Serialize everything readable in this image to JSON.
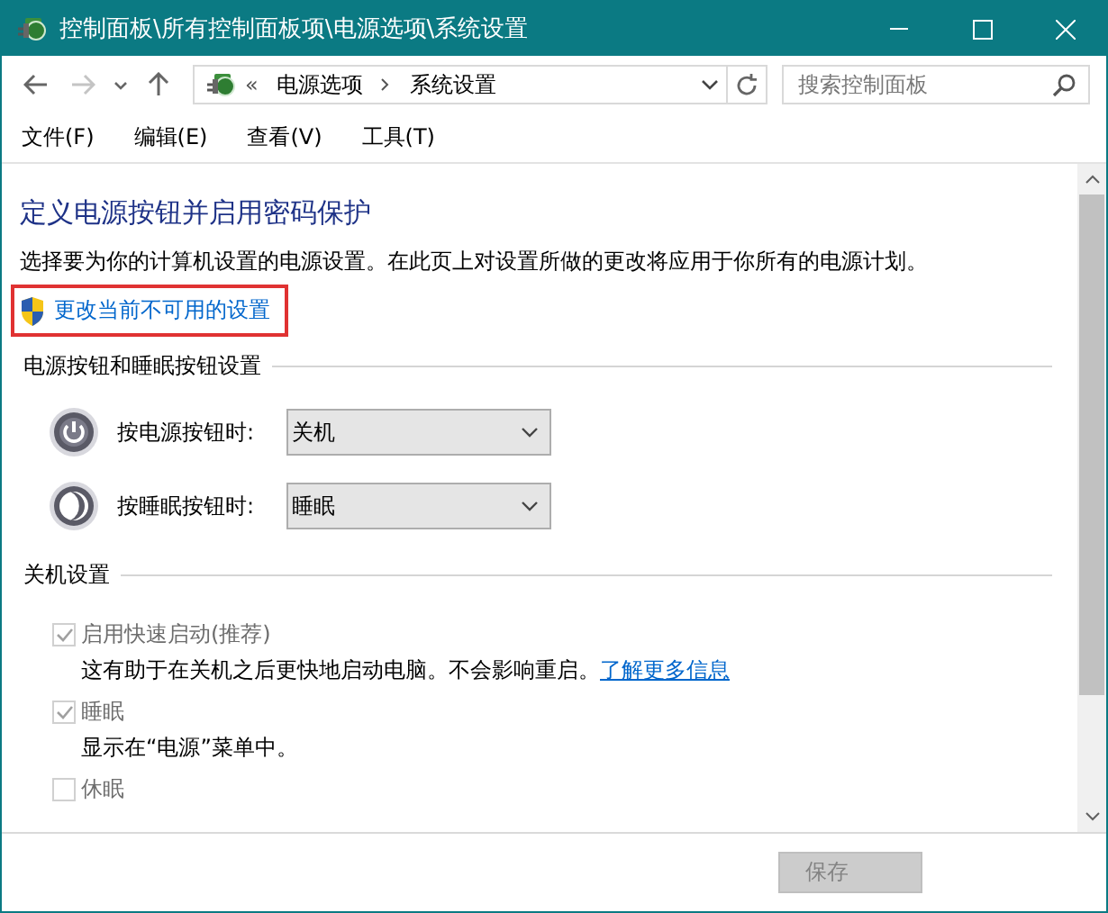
{
  "window": {
    "title": "控制面板\\所有控制面板项\\电源选项\\系统设置"
  },
  "nav_buttons": [
    {
      "kind": "back",
      "disabled": false
    },
    {
      "kind": "forward",
      "disabled": true
    },
    {
      "kind": "recent",
      "disabled": false
    },
    {
      "kind": "up",
      "disabled": false
    }
  ],
  "address": {
    "overflow": "«",
    "crumbs": [
      "电源选项",
      "系统设置"
    ]
  },
  "search": {
    "placeholder": "搜索控制面板"
  },
  "menu": [
    "文件(F)",
    "编辑(E)",
    "查看(V)",
    "工具(T)"
  ],
  "page": {
    "heading": "定义电源按钮并启用密码保护",
    "description": "选择要为你的计算机设置的电源设置。在此页上对设置所做的更改将应用于你所有的电源计划。",
    "admin_link": "更改当前不可用的设置",
    "sections": [
      {
        "title": "电源按钮和睡眠按钮设置",
        "kind": "buttons",
        "rows": [
          {
            "kind": "power",
            "label": "按电源按钮时:",
            "value": "关机"
          },
          {
            "kind": "sleep",
            "label": "按睡眠按钮时:",
            "value": "睡眠"
          }
        ]
      },
      {
        "title": "关机设置",
        "kind": "options",
        "options": [
          {
            "label": "启用快速启动(推荐)",
            "checked": true,
            "disabled": true,
            "description": "这有助于在关机之后更快地启动电脑。不会影响重启。",
            "link": "了解更多信息"
          },
          {
            "label": "睡眠",
            "checked": true,
            "disabled": true,
            "description": "显示在“电源”菜单中。"
          },
          {
            "label": "休眠",
            "checked": false,
            "disabled": true
          }
        ]
      }
    ]
  },
  "footer": {
    "buttons": [
      {
        "label": "保存",
        "disabled": true
      }
    ]
  }
}
